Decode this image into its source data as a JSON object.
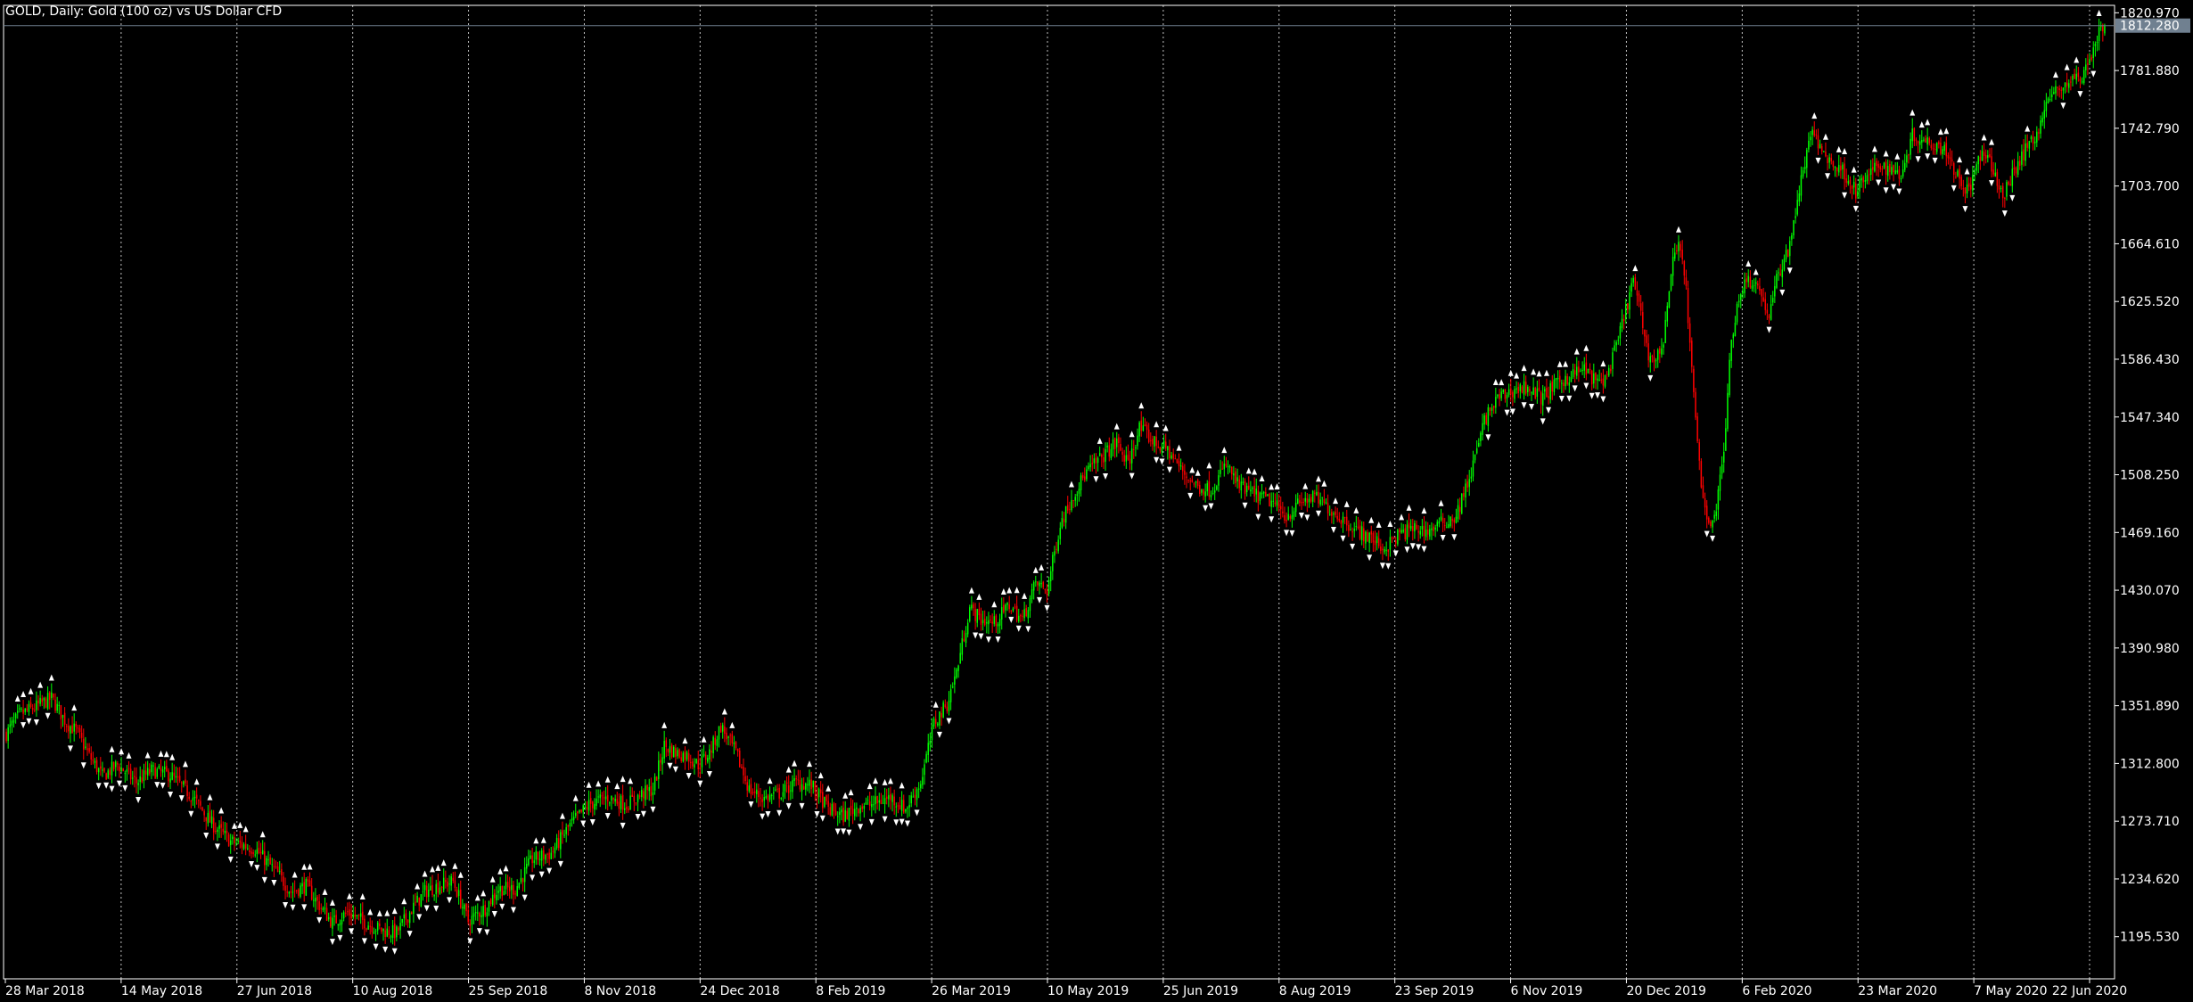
{
  "window": {
    "title": "GOLD, Daily:  Gold (100 oz) vs US Dollar CFD"
  },
  "colors": {
    "background": "#000000",
    "foreground": "#ffffff",
    "grid": "#c0c0c0",
    "bull_candle": "#00ff00",
    "bear_candle": "#ff0000",
    "bid_line": "#708090",
    "price_tag_bg": "#708090",
    "fractal_marker": "#ffffff"
  },
  "chart_data": {
    "type": "candlestick",
    "title": "GOLD, Daily:  Gold (100 oz) vs US Dollar CFD",
    "symbol": "GOLD",
    "timeframe": "Daily",
    "ylim": [
      1167.0,
      1826.0
    ],
    "y_ticks": [
      {
        "value": 1820.97,
        "label": "1820.970"
      },
      {
        "value": 1781.88,
        "label": "1781.880"
      },
      {
        "value": 1742.79,
        "label": "1742.790"
      },
      {
        "value": 1703.7,
        "label": "1703.700"
      },
      {
        "value": 1664.61,
        "label": "1664.610"
      },
      {
        "value": 1625.52,
        "label": "1625.520"
      },
      {
        "value": 1586.43,
        "label": "1586.430"
      },
      {
        "value": 1547.34,
        "label": "1547.340"
      },
      {
        "value": 1508.25,
        "label": "1508.250"
      },
      {
        "value": 1469.16,
        "label": "1469.160"
      },
      {
        "value": 1430.07,
        "label": "1430.070"
      },
      {
        "value": 1390.98,
        "label": "1390.980"
      },
      {
        "value": 1351.89,
        "label": "1351.890"
      },
      {
        "value": 1312.8,
        "label": "1312.800"
      },
      {
        "value": 1273.71,
        "label": "1273.710"
      },
      {
        "value": 1234.62,
        "label": "1234.620"
      },
      {
        "value": 1195.53,
        "label": "1195.530"
      }
    ],
    "x_ticks": [
      "28 Mar 2018",
      "14 May 2018",
      "27 Jun 2018",
      "10 Aug 2018",
      "25 Sep 2018",
      "8 Nov 2018",
      "24 Dec 2018",
      "8 Feb 2019",
      "26 Mar 2019",
      "10 May 2019",
      "25 Jun 2019",
      "8 Aug 2019",
      "23 Sep 2019",
      "6 Nov 2019",
      "20 Dec 2019",
      "6 Feb 2020",
      "23 Mar 2020",
      "7 May 2020",
      "22 Jun 2020"
    ],
    "current_price": {
      "value": 1812.28,
      "label": "1812.280"
    },
    "grid": true,
    "fractal_markers": true,
    "close_path": [
      [
        1,
        1333
      ],
      [
        8,
        1346
      ],
      [
        15,
        1350
      ],
      [
        25,
        1357
      ],
      [
        33,
        1340
      ],
      [
        38,
        1335
      ],
      [
        45,
        1318
      ],
      [
        52,
        1304
      ],
      [
        60,
        1312
      ],
      [
        70,
        1300
      ],
      [
        78,
        1308
      ],
      [
        88,
        1305
      ],
      [
        100,
        1290
      ],
      [
        110,
        1272
      ],
      [
        120,
        1260
      ],
      [
        133,
        1255
      ],
      [
        145,
        1238
      ],
      [
        152,
        1226
      ],
      [
        160,
        1230
      ],
      [
        168,
        1215
      ],
      [
        174,
        1205
      ],
      [
        182,
        1212
      ],
      [
        192,
        1205
      ],
      [
        200,
        1200
      ],
      [
        208,
        1198
      ],
      [
        216,
        1214
      ],
      [
        223,
        1226
      ],
      [
        230,
        1230
      ],
      [
        238,
        1233
      ],
      [
        246,
        1206
      ],
      [
        255,
        1215
      ],
      [
        262,
        1228
      ],
      [
        271,
        1228
      ],
      [
        280,
        1248
      ],
      [
        290,
        1252
      ],
      [
        300,
        1271
      ],
      [
        310,
        1285
      ],
      [
        320,
        1290
      ],
      [
        330,
        1285
      ],
      [
        338,
        1292
      ],
      [
        344,
        1295
      ],
      [
        350,
        1325
      ],
      [
        356,
        1320
      ],
      [
        362,
        1318
      ],
      [
        368,
        1312
      ],
      [
        374,
        1320
      ],
      [
        380,
        1338
      ],
      [
        388,
        1320
      ],
      [
        395,
        1295
      ],
      [
        403,
        1289
      ],
      [
        412,
        1293
      ],
      [
        420,
        1300
      ],
      [
        428,
        1298
      ],
      [
        437,
        1282
      ],
      [
        445,
        1277
      ],
      [
        453,
        1284
      ],
      [
        460,
        1285
      ],
      [
        470,
        1290
      ],
      [
        478,
        1282
      ],
      [
        486,
        1300
      ],
      [
        493,
        1340
      ],
      [
        500,
        1353
      ],
      [
        505,
        1375
      ],
      [
        512,
        1418
      ],
      [
        518,
        1410
      ],
      [
        525,
        1408
      ],
      [
        533,
        1420
      ],
      [
        540,
        1410
      ],
      [
        547,
        1435
      ],
      [
        553,
        1430
      ],
      [
        560,
        1475
      ],
      [
        567,
        1495
      ],
      [
        574,
        1510
      ],
      [
        582,
        1520
      ],
      [
        590,
        1530
      ],
      [
        596,
        1515
      ],
      [
        602,
        1540
      ],
      [
        610,
        1530
      ],
      [
        617,
        1525
      ],
      [
        625,
        1510
      ],
      [
        633,
        1500
      ],
      [
        640,
        1498
      ],
      [
        648,
        1515
      ],
      [
        655,
        1500
      ],
      [
        663,
        1495
      ],
      [
        672,
        1490
      ],
      [
        680,
        1480
      ],
      [
        688,
        1490
      ],
      [
        695,
        1493
      ],
      [
        703,
        1485
      ],
      [
        710,
        1478
      ],
      [
        718,
        1470
      ],
      [
        725,
        1465
      ],
      [
        732,
        1458
      ],
      [
        740,
        1468
      ],
      [
        748,
        1472
      ],
      [
        755,
        1470
      ],
      [
        762,
        1475
      ],
      [
        770,
        1480
      ],
      [
        778,
        1510
      ],
      [
        785,
        1545
      ],
      [
        792,
        1560
      ],
      [
        800,
        1565
      ],
      [
        808,
        1568
      ],
      [
        815,
        1560
      ],
      [
        822,
        1568
      ],
      [
        830,
        1575
      ],
      [
        838,
        1580
      ],
      [
        845,
        1570
      ],
      [
        850,
        1575
      ],
      [
        855,
        1595
      ],
      [
        860,
        1620
      ],
      [
        864,
        1640
      ],
      [
        868,
        1615
      ],
      [
        872,
        1590
      ],
      [
        876,
        1585
      ],
      [
        880,
        1600
      ],
      [
        884,
        1645
      ],
      [
        888,
        1670
      ],
      [
        892,
        1632
      ],
      [
        896,
        1560
      ],
      [
        900,
        1500
      ],
      [
        904,
        1475
      ],
      [
        908,
        1485
      ],
      [
        912,
        1525
      ],
      [
        916,
        1600
      ],
      [
        920,
        1630
      ],
      [
        924,
        1640
      ],
      [
        928,
        1640
      ],
      [
        932,
        1630
      ],
      [
        936,
        1615
      ],
      [
        940,
        1640
      ],
      [
        946,
        1660
      ],
      [
        952,
        1700
      ],
      [
        958,
        1740
      ],
      [
        964,
        1728
      ],
      [
        970,
        1718
      ],
      [
        976,
        1713
      ],
      [
        982,
        1700
      ],
      [
        988,
        1710
      ],
      [
        994,
        1718
      ],
      [
        1000,
        1715
      ],
      [
        1006,
        1712
      ],
      [
        1012,
        1738
      ],
      [
        1018,
        1735
      ],
      [
        1024,
        1733
      ],
      [
        1030,
        1728
      ],
      [
        1036,
        1710
      ],
      [
        1042,
        1700
      ],
      [
        1048,
        1725
      ],
      [
        1054,
        1718
      ],
      [
        1060,
        1695
      ],
      [
        1066,
        1715
      ],
      [
        1072,
        1728
      ],
      [
        1078,
        1740
      ],
      [
        1084,
        1762
      ],
      [
        1090,
        1770
      ],
      [
        1096,
        1775
      ],
      [
        1102,
        1778
      ],
      [
        1106,
        1790
      ],
      [
        1110,
        1805
      ],
      [
        1114,
        1812.28
      ]
    ]
  }
}
